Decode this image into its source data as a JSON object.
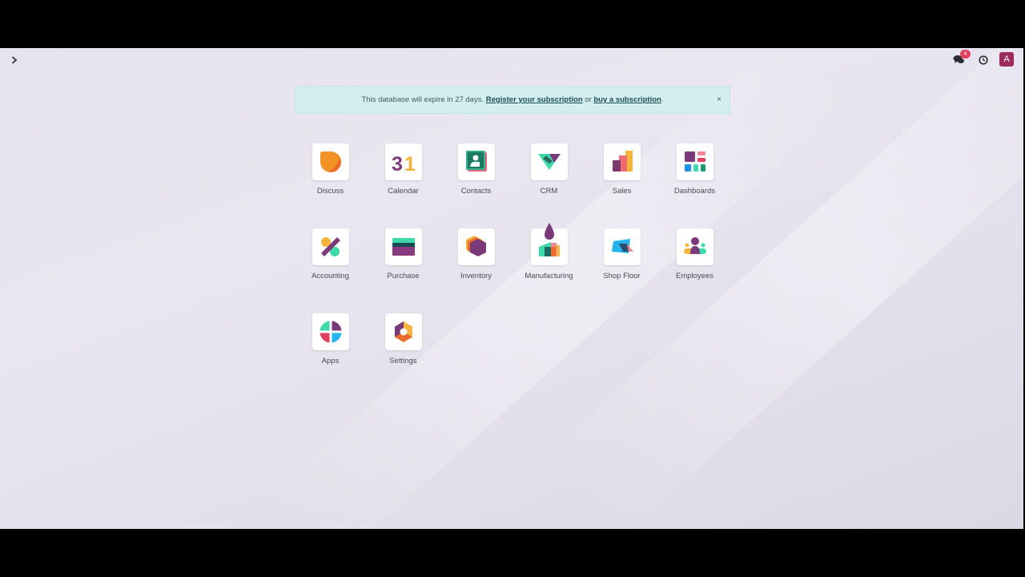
{
  "navbar": {
    "menu_toggle_icon": "chevron-right-icon",
    "messages_badge": "4",
    "avatar_initial": "A"
  },
  "banner": {
    "text": "This database will expire in 27 days. ",
    "register_link": "Register your subscription",
    "or_text": " or ",
    "buy_link": "buy a subscription",
    "end_text": ".",
    "close_label": "×"
  },
  "apps": [
    {
      "label": "Discuss",
      "icon": "discuss-icon"
    },
    {
      "label": "Calendar",
      "icon": "calendar-icon",
      "icon_text": "31"
    },
    {
      "label": "Contacts",
      "icon": "contacts-icon"
    },
    {
      "label": "CRM",
      "icon": "crm-icon"
    },
    {
      "label": "Sales",
      "icon": "sales-icon"
    },
    {
      "label": "Dashboards",
      "icon": "dashboards-icon"
    },
    {
      "label": "Accounting",
      "icon": "accounting-icon"
    },
    {
      "label": "Purchase",
      "icon": "purchase-icon"
    },
    {
      "label": "Inventory",
      "icon": "inventory-icon"
    },
    {
      "label": "Manufacturing",
      "icon": "manufacturing-icon"
    },
    {
      "label": "Shop Floor",
      "icon": "shop-floor-icon"
    },
    {
      "label": "Employees",
      "icon": "employees-icon"
    },
    {
      "label": "Apps",
      "icon": "apps-icon"
    },
    {
      "label": "Settings",
      "icon": "settings-icon"
    }
  ],
  "colors": {
    "brand": "#9b2c5c",
    "banner_bg": "#d3eeee",
    "badge": "#e0405e"
  }
}
